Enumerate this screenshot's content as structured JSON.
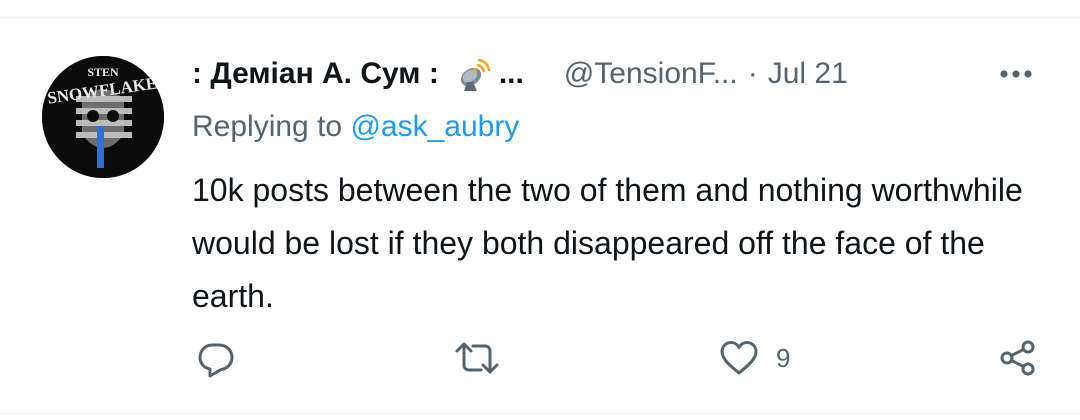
{
  "tweet": {
    "display_name": ": Деміан А. Сум :",
    "name_suffix": "...",
    "handle": "@TensionF...",
    "separator": "·",
    "date": "Jul 21",
    "reply_prefix": "Replying to ",
    "reply_to": "@ask_aubry",
    "text": "10k posts between the two of them and nothing worthwhile would be lost if they both disappeared off the face of the earth.",
    "avatar_text": "SNOWFLAKE",
    "actions": {
      "reply_count": "",
      "retweet_count": "",
      "like_count": "9"
    },
    "colors": {
      "link": "#1d9bf0",
      "secondary": "#536471",
      "primary": "#0f1419"
    }
  }
}
